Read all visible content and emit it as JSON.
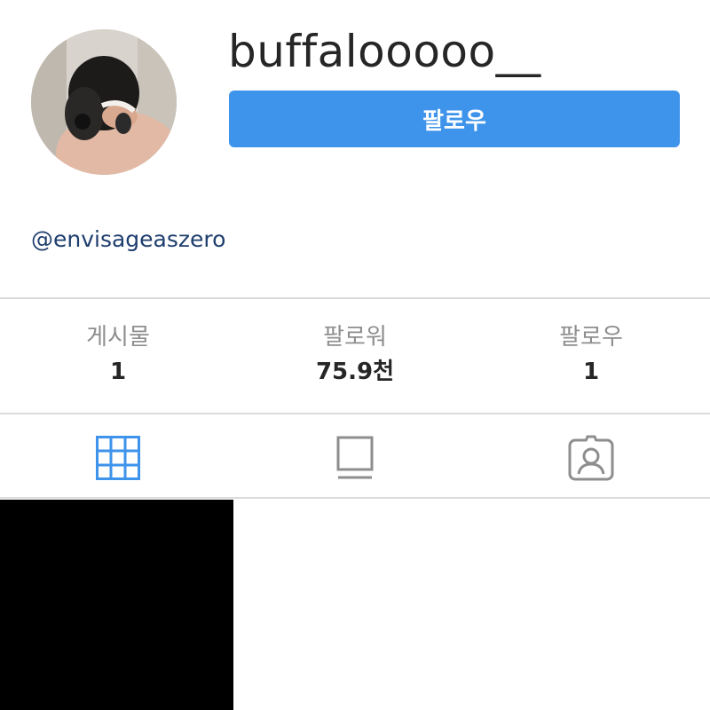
{
  "profile": {
    "username": "buffalooooo__",
    "follow_label": "팔로우",
    "bio_link": "@envisageaszero"
  },
  "stats": [
    {
      "label": "게시물",
      "value": "1"
    },
    {
      "label": "팔로워",
      "value": "75.9천"
    },
    {
      "label": "팔로우",
      "value": "1"
    }
  ],
  "tabs": [
    {
      "icon": "grid-icon",
      "active": true
    },
    {
      "icon": "feed-icon",
      "active": false
    },
    {
      "icon": "tagged-icon",
      "active": false
    }
  ],
  "colors": {
    "accent": "#3e93eb",
    "link": "#1f3e6e",
    "muted": "#8e8e8e",
    "divider": "#dbdbdb",
    "active_tab": "#3e93eb",
    "inactive_tab": "#8e8e8e"
  },
  "posts": [
    {
      "thumbnail": "black"
    }
  ]
}
